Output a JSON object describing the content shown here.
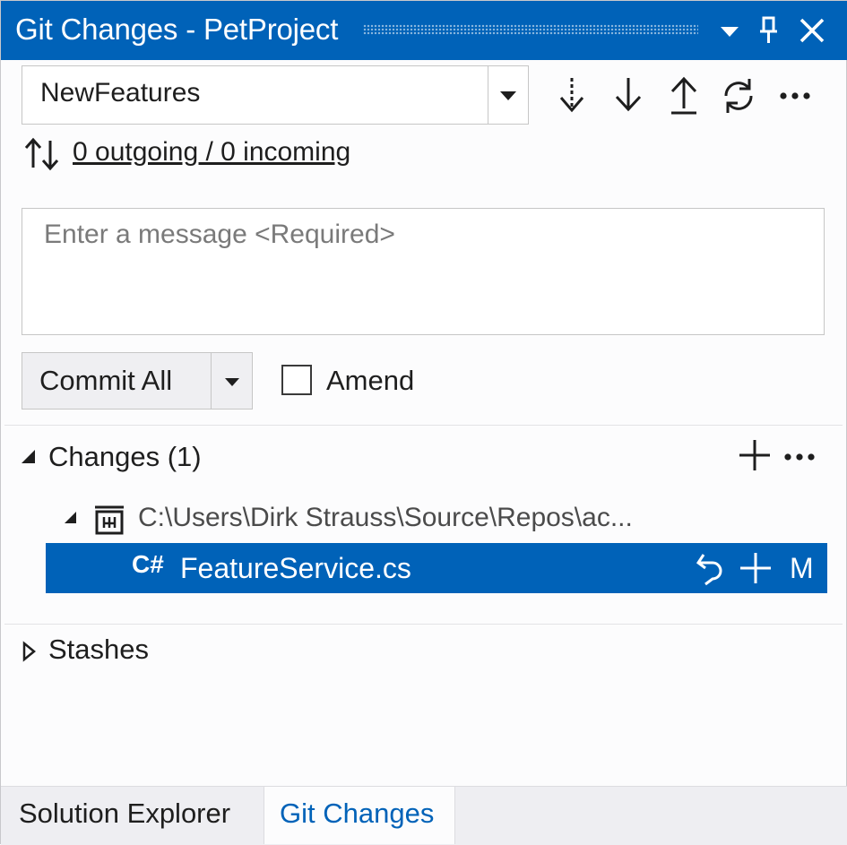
{
  "window": {
    "title": "Git Changes - PetProject",
    "controls": [
      "chevron-down-icon",
      "pin-icon",
      "close-icon"
    ]
  },
  "branch": {
    "selected": "NewFeatures",
    "actions": [
      "fetch-icon",
      "pull-icon",
      "push-icon",
      "sync-icon",
      "more-icon"
    ]
  },
  "sync": {
    "status": "0 outgoing / 0 incoming"
  },
  "commit_message": {
    "value": "",
    "placeholder": "Enter a message <Required>"
  },
  "commit": {
    "label": "Commit All",
    "amend_label": "Amend",
    "amend_checked": false
  },
  "changes": {
    "header": "Changes (1)",
    "expanded": true,
    "repo_path": "C:\\Users\\Dirk Strauss\\Source\\Repos\\ac...",
    "files": [
      {
        "language": "C#",
        "name": "FeatureService.cs",
        "status": "M",
        "selected": true
      }
    ]
  },
  "stashes": {
    "header": "Stashes",
    "expanded": false
  },
  "tabs": [
    {
      "label": "Solution Explorer",
      "active": false
    },
    {
      "label": "Git Changes",
      "active": true
    }
  ],
  "colors": {
    "accent": "#0062b8",
    "background": "#fcfcfd",
    "tab_strip": "#eeeef2"
  }
}
